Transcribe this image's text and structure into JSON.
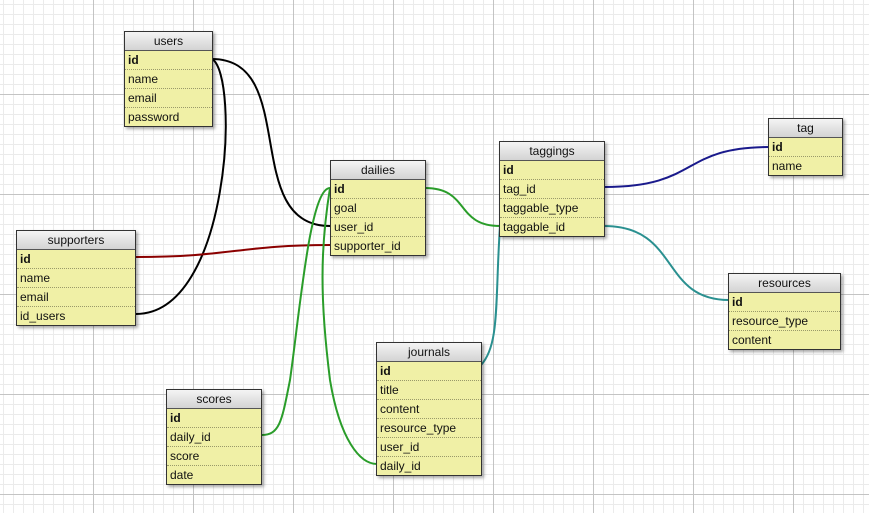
{
  "tables": [
    {
      "key": "users",
      "name": "users",
      "fields": [
        {
          "name": "id",
          "pk": true
        },
        {
          "name": "name"
        },
        {
          "name": "email"
        },
        {
          "name": "password"
        }
      ]
    },
    {
      "key": "dailies",
      "name": "dailies",
      "fields": [
        {
          "name": "id",
          "pk": true
        },
        {
          "name": "goal"
        },
        {
          "name": "user_id"
        },
        {
          "name": "supporter_id"
        }
      ]
    },
    {
      "key": "taggings",
      "name": "taggings",
      "fields": [
        {
          "name": "id",
          "pk": true
        },
        {
          "name": "tag_id"
        },
        {
          "name": "taggable_type"
        },
        {
          "name": "taggable_id"
        }
      ]
    },
    {
      "key": "tag",
      "name": "tag",
      "fields": [
        {
          "name": "id",
          "pk": true
        },
        {
          "name": "name"
        }
      ]
    },
    {
      "key": "supporters",
      "name": "supporters",
      "fields": [
        {
          "name": "id",
          "pk": true
        },
        {
          "name": "name"
        },
        {
          "name": "email"
        },
        {
          "name": "id_users"
        }
      ]
    },
    {
      "key": "resources",
      "name": "resources",
      "fields": [
        {
          "name": "id",
          "pk": true
        },
        {
          "name": "resource_type"
        },
        {
          "name": "content"
        }
      ]
    },
    {
      "key": "journals",
      "name": "journals",
      "fields": [
        {
          "name": "id",
          "pk": true
        },
        {
          "name": "title"
        },
        {
          "name": "content"
        },
        {
          "name": "resource_type"
        },
        {
          "name": "user_id"
        },
        {
          "name": "daily_id"
        }
      ]
    },
    {
      "key": "scores",
      "name": "scores",
      "fields": [
        {
          "name": "id",
          "pk": true
        },
        {
          "name": "daily_id"
        },
        {
          "name": "score"
        },
        {
          "name": "date"
        }
      ]
    }
  ],
  "relations": [
    {
      "from": "users.id",
      "to": "dailies.user_id",
      "color": "#000000"
    },
    {
      "from": "users.id",
      "to": "supporters.id_users",
      "color": "#000000"
    },
    {
      "from": "supporters.id",
      "to": "dailies.supporter_id",
      "color": "#8b0000"
    },
    {
      "from": "dailies.id",
      "to": "scores.daily_id",
      "color": "#2a9d2a"
    },
    {
      "from": "dailies.id",
      "to": "journals.daily_id",
      "color": "#2a9d2a"
    },
    {
      "from": "dailies.id",
      "to": "taggings.taggable_id",
      "color": "#2a9d2a"
    },
    {
      "from": "taggings.tag_id",
      "to": "tag.id",
      "color": "#1a1a8c"
    },
    {
      "from": "taggings.taggable_id",
      "to": "resources.id",
      "color": "#2a9090"
    },
    {
      "from": "taggings.taggable_id",
      "to": "journals.id",
      "color": "#2a9090"
    }
  ]
}
